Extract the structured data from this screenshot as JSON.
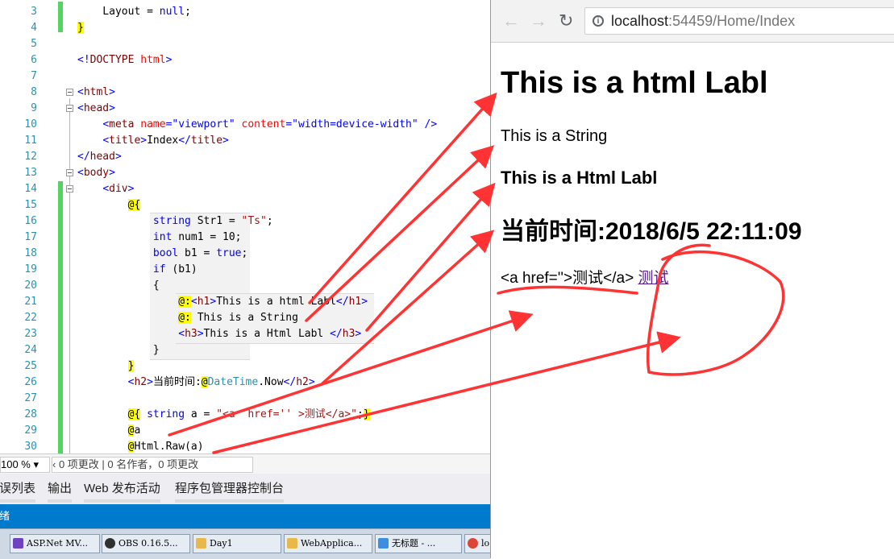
{
  "editor": {
    "lines": [
      {
        "num": "3",
        "html": "    Layout = <span class='k'>null</span>;"
      },
      {
        "num": "4",
        "html": "<span class='at'>}</span>"
      },
      {
        "num": "5",
        "html": ""
      },
      {
        "num": "6",
        "html": "<span class='s'>&lt;!</span><span class='t'>DOCTYPE</span> <span class='a'>html</span><span class='s'>&gt;</span>"
      },
      {
        "num": "7",
        "html": ""
      },
      {
        "num": "8",
        "html": "<span class='s'>&lt;</span><span class='t'>html</span><span class='s'>&gt;</span>"
      },
      {
        "num": "9",
        "html": "<span class='s'>&lt;</span><span class='t'>head</span><span class='s'>&gt;</span>"
      },
      {
        "num": "10",
        "html": "    <span class='s'>&lt;</span><span class='t'>meta</span> <span class='a'>name</span><span class='s'>=\"viewport\"</span> <span class='a'>content</span><span class='s'>=\"width=device-width\"</span> <span class='s'>/&gt;</span>"
      },
      {
        "num": "11",
        "html": "    <span class='s'>&lt;</span><span class='t'>title</span><span class='s'>&gt;</span>Index<span class='s'>&lt;/</span><span class='t'>title</span><span class='s'>&gt;</span>"
      },
      {
        "num": "12",
        "html": "<span class='s'>&lt;/</span><span class='t'>head</span><span class='s'>&gt;</span>"
      },
      {
        "num": "13",
        "html": "<span class='s'>&lt;</span><span class='t'>body</span><span class='s'>&gt;</span>"
      },
      {
        "num": "14",
        "html": "    <span class='s'>&lt;</span><span class='t'>div</span><span class='s'>&gt;</span>"
      },
      {
        "num": "15",
        "html": "        <span class='at'>@{</span>"
      },
      {
        "num": "16",
        "html": "            <span class='k'>string</span> Str1 = <span class='str'>\"Ts\"</span>;"
      },
      {
        "num": "17",
        "html": "            <span class='k'>int</span> num1 = 10;"
      },
      {
        "num": "18",
        "html": "            <span class='k'>bool</span> b1 = <span class='k'>true</span>;"
      },
      {
        "num": "19",
        "html": "            <span class='k'>if</span> (b1)"
      },
      {
        "num": "20",
        "html": "            {"
      },
      {
        "num": "21",
        "html": "                <span class='at'>@:</span><span class='s'>&lt;</span><span class='t'>h1</span><span class='s'>&gt;</span>This is a html Labl<span class='s'>&lt;/</span><span class='t'>h1</span><span class='s'>&gt;</span>"
      },
      {
        "num": "22",
        "html": "                <span class='at'>@:</span> This is a String"
      },
      {
        "num": "23",
        "html": "                <span class='s'>&lt;</span><span class='t'>h3</span><span class='s'>&gt;</span>This is a Html Labl <span class='s'>&lt;/</span><span class='t'>h3</span><span class='s'>&gt;</span>"
      },
      {
        "num": "24",
        "html": "            }"
      },
      {
        "num": "25",
        "html": "        <span class='at'>}</span>"
      },
      {
        "num": "26",
        "html": "        <span class='s'>&lt;</span><span class='t'>h2</span><span class='s'>&gt;</span>当前时间:<span class='at'>@</span><span class='cls'>DateTime</span>.Now<span class='s'>&lt;/</span><span class='t'>h2</span><span class='s'>&gt;</span>"
      },
      {
        "num": "27",
        "html": ""
      },
      {
        "num": "28",
        "html": "        <span class='at'>@{</span> <span class='k'>string</span> a = <span class='str'>\"&lt;a  href='' &gt;测试&lt;/a&gt;\"</span>;<span class='at'>}</span>"
      },
      {
        "num": "29",
        "html": "        <span class='at'>@</span>a"
      },
      {
        "num": "30",
        "html": "        <span class='at'>@</span>Html.Raw(a)"
      }
    ],
    "zoom": "100 %",
    "changes_text": "0 项更改 | 0 名作者，0 项更改",
    "tool_tabs": [
      "错误列表",
      "输出",
      "Web 发布活动",
      "程序包管理器控制台"
    ],
    "status_text": "就绪"
  },
  "taskbar": {
    "items": [
      {
        "label": "ASP.Net MV...",
        "color": "#6f42c1"
      },
      {
        "label": "OBS 0.16.5...",
        "color": "#303030"
      },
      {
        "label": "Day1",
        "color": "#e8b84a"
      },
      {
        "label": "WebApplica...",
        "color": "#e8b84a"
      },
      {
        "label": "无标题 - ...",
        "color": "#3d8ee0"
      },
      {
        "label": "lo",
        "color": "#db4437"
      }
    ]
  },
  "browser": {
    "url_host": "localhost",
    "url_rest": ":54459/Home/Index",
    "page": {
      "h1": "This is a html Labl",
      "string_line": "This is a String",
      "h3": "This is a Html Labl",
      "h2": "当前时间:2018/6/5 22:11:09",
      "raw_text": "<a href=''>测试</a>",
      "link_text": "测试"
    }
  },
  "colors": {
    "annotation": "#ff3333",
    "vs_status": "#007acc",
    "gutter_change": "#57d364"
  }
}
